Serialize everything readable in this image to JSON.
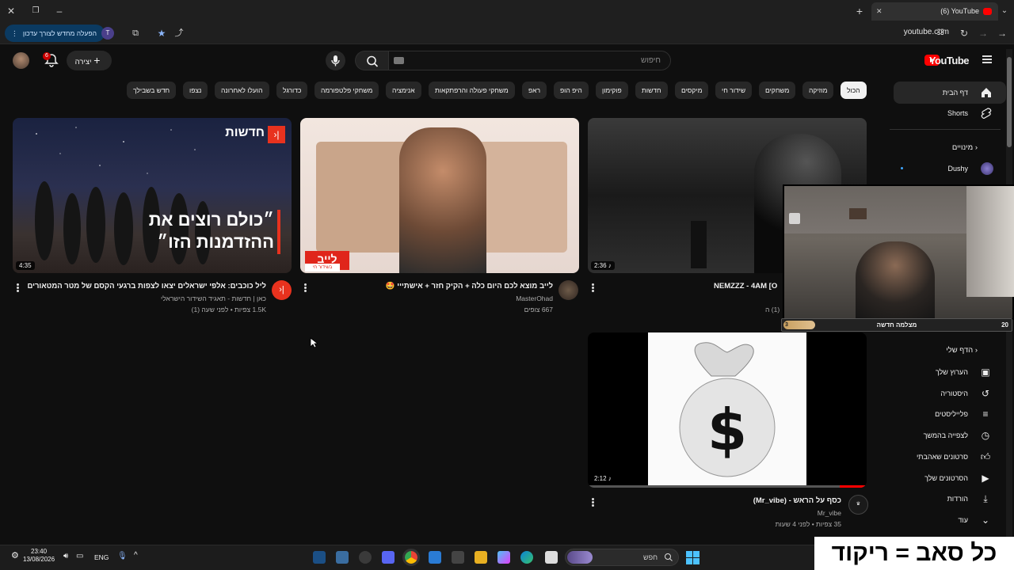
{
  "browser": {
    "tab_title": "(6) YouTube",
    "url": "youtube.com",
    "extension_button": "הפעלה מחדש לצורך עדכון",
    "profile_letter": "T"
  },
  "youtube": {
    "search_placeholder": "חיפוש",
    "create_label": "יצירה",
    "notif_count": "6",
    "logo_text": "YouTube",
    "chips": [
      "הכול",
      "מוזיקה",
      "משחקים",
      "שידור חי",
      "מיקסים",
      "חדשות",
      "פוקימון",
      "היפ הופ",
      "ראפ",
      "משחקי פעולה והרפתקאות",
      "אנימציה",
      "משחקי פלטפורמה",
      "כדורגל",
      "הועלו לאחרונה",
      "נצפו",
      "חדש בשבילך"
    ],
    "sidebar": {
      "home": "דף הבית",
      "shorts": "Shorts",
      "subscriptions_heading": "מינויים",
      "sub_channel": "Dushy",
      "you_heading": "הדף שלי",
      "items": [
        "הערוץ שלך",
        "היסטוריה",
        "פלייליסטים",
        "לצפייה בהמשך",
        "סרטונים שאהבתי",
        "הסרטונים שלך",
        "הורדות",
        "עוד"
      ]
    },
    "videos": [
      {
        "title": "ליל כוכבים: אלפי ישראלים יצאו לצפות ברגעי הקסם של מטר המטאורים",
        "channel": "כאן | חדשות - תאגיד השידור הישראלי",
        "meta": "1.5K צפיות • לפני שעה (1)",
        "duration": "4:35",
        "overlay_tag": "חדשות",
        "overlay_text_1": "״כולם רוצים את",
        "overlay_text_2": "ההזדמנות הזו״"
      },
      {
        "title": "לייב מוצא לכם היום כלה + הקיק חזר + אישתייי 🤩",
        "channel": "MasterOhad",
        "meta": "667 צופים",
        "live_label": "לייב",
        "live_sub": "בשידור חי"
      },
      {
        "title": "NEMZZZ - 4AM [O",
        "meta": "(1) ה",
        "duration": "2:36"
      },
      {
        "title": "כסף על הראש - (Mr_vibe)",
        "channel": "Mr_vibe",
        "meta": "35 צפיות • לפני 4 שעות",
        "duration": "2:12"
      }
    ]
  },
  "stream_overlay": {
    "goal_label": "מצלמה חדשה",
    "goal_current": "3",
    "goal_target": "20",
    "subtitle_text": "כל סאב = ריקוד"
  },
  "taskbar": {
    "time": "23:40",
    "date": "13/08/2026",
    "lang": "ENG",
    "search_placeholder": "חפש"
  }
}
